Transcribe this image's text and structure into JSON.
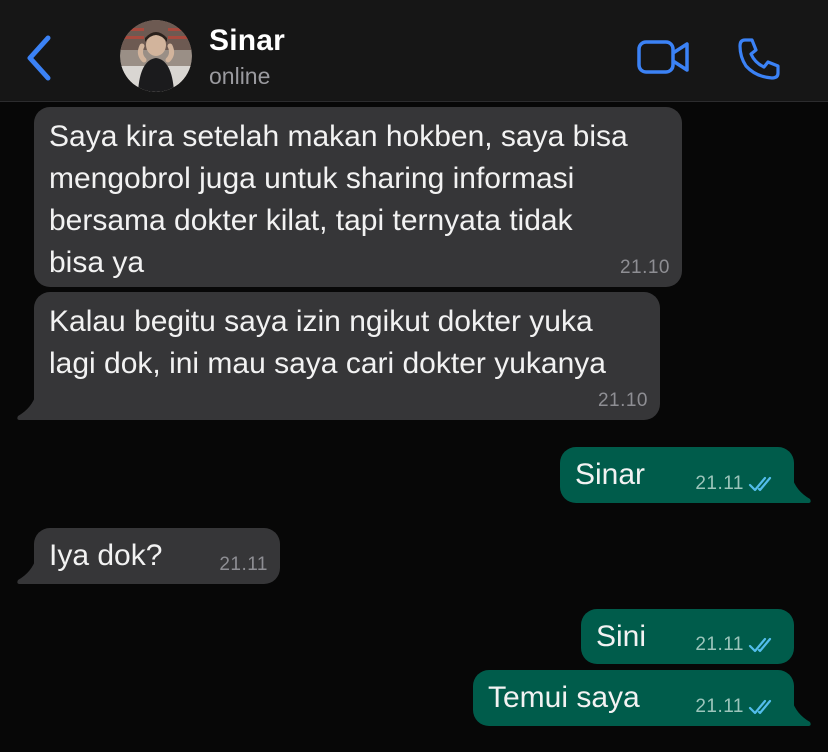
{
  "header": {
    "contact_name": "Sinar",
    "contact_status": "online",
    "accent_color": "#3b82f6"
  },
  "icons": {
    "back": "chevron-left-icon",
    "video": "video-camera-icon",
    "call": "phone-icon",
    "read_receipt": "double-check-icon"
  },
  "messages": [
    {
      "direction": "incoming",
      "text": "Saya kira setelah makan hokben, saya bisa\nmengobrol juga untuk sharing informasi\nbersama dokter kilat, tapi ternyata tidak\nbisa ya",
      "time": "21.10"
    },
    {
      "direction": "incoming",
      "text": "Kalau begitu saya izin ngikut dokter yuka\nlagi dok, ini mau saya cari dokter yukanya",
      "time": "21.10"
    },
    {
      "direction": "outgoing",
      "text": "Sinar",
      "time": "21.11",
      "status": "read"
    },
    {
      "direction": "incoming",
      "text": "Iya dok?",
      "time": "21.11"
    },
    {
      "direction": "outgoing",
      "text": "Sini",
      "time": "21.11",
      "status": "read"
    },
    {
      "direction": "outgoing",
      "text": "Temui saya",
      "time": "21.11",
      "status": "read"
    }
  ],
  "colors": {
    "incoming_bubble": "#363638",
    "outgoing_bubble": "#005c4b",
    "read_tick": "#53bdeb"
  }
}
